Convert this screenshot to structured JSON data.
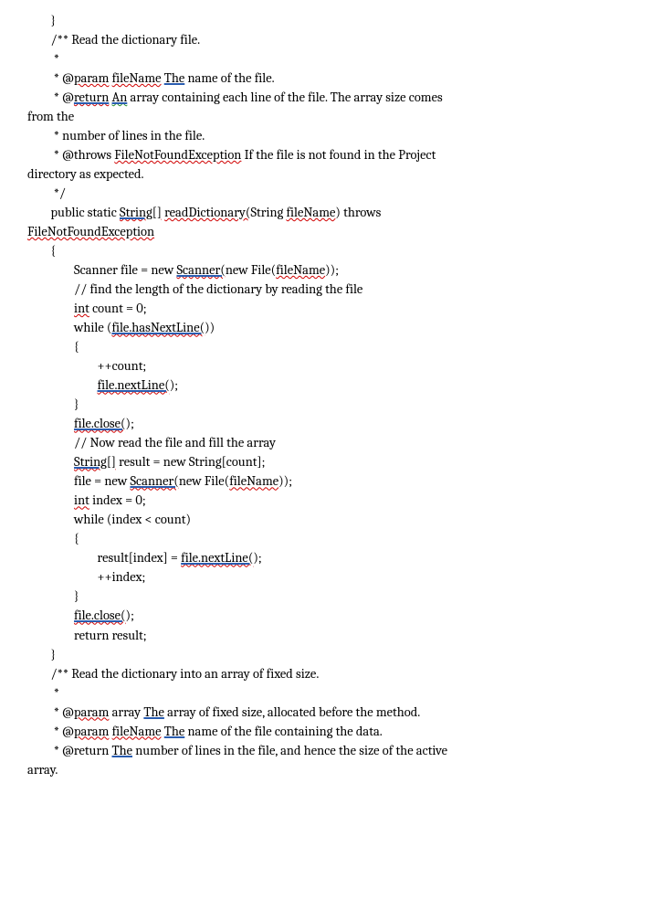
{
  "l1": "        }",
  "l2": "",
  "l3a": "        /** Read the dictionary file.",
  "l4": "         *",
  "l5_pre": "         * @",
  "l5_param": "param",
  "l5_sp": " ",
  "l5_fn": "fileName",
  "l5_sp2": " ",
  "l5_the": "The",
  "l5_rest": " name of the file.",
  "l6_pre": "         * @",
  "l6_ret": "return",
  "l6_sp": " ",
  "l6_an": "An",
  "l6_rest": " array containing each line of the file. The array size comes",
  "l7": "from the",
  "l8": "         * number of lines in the file.",
  "l9_pre": "         * @throws ",
  "l9_ex": "FileNotFoundException",
  "l9_rest": " If the file is not found in the Project",
  "l10": "directory as expected.",
  "l11": "         */",
  "l12_pre": "        public static ",
  "l12_str": "String[]",
  "l12_sp": " ",
  "l12_rd": "readDictionary(",
  "l12_mid": "String ",
  "l12_fn": "fileName",
  "l12_end": ") throws",
  "l13": "FileNotFoundException",
  "l14": "        {",
  "l15_pre": "                Scanner file = new ",
  "l15_scan": "Scanner(",
  "l15_mid": "new File(",
  "l15_fn": "fileName",
  "l15_end": "));",
  "l16": "",
  "l17": "                // find the length of the dictionary by reading the file",
  "l18_pre": "                ",
  "l18_int": "int",
  "l18_rest": " count = 0;",
  "l19_pre": "                while (",
  "l19_call": "file.hasNextLine(",
  "l19_end": "))",
  "l20": "                {",
  "l21": "                        ++count;",
  "l22_pre": "                        ",
  "l22_call": "file.nextLine(",
  "l22_end": ");",
  "l23": "                }",
  "l24_pre": "                ",
  "l24_call": "file.close(",
  "l24_end": ");",
  "l25": "",
  "l26": "                // Now read the file and fill the array",
  "l27_pre": "                ",
  "l27_str": "String[]",
  "l27_rest": " result = new String[count];",
  "l28_pre": "                file = new ",
  "l28_scan": "Scanner(",
  "l28_mid": "new File(",
  "l28_fn": "fileName",
  "l28_end": "));",
  "l29_pre": "                ",
  "l29_int": "int",
  "l29_rest": " index = 0;",
  "l30": "                while (index < count)",
  "l31": "                {",
  "l32_pre": "                        result[index] = ",
  "l32_call": "file.nextLine(",
  "l32_end": ");",
  "l33": "                        ++index;",
  "l34": "                }",
  "l35_pre": "                ",
  "l35_call": "file.close(",
  "l35_end": ");",
  "l36": "                return result;",
  "l37": "",
  "l38": "        }",
  "l39": "",
  "l40": "        /** Read the dictionary into an array of fixed size.",
  "l41": "         *",
  "l42_pre": "         * @",
  "l42_param": "param",
  "l42_sp": " ",
  "l42_arr": "array ",
  "l42_the": "The",
  "l42_rest": " array of fixed size, allocated before the method.",
  "l43_pre": "         * @",
  "l43_param": "param",
  "l43_sp": " ",
  "l43_fn": "fileName",
  "l43_sp2": " ",
  "l43_the": "The",
  "l43_rest": " name of the file containing the data.",
  "l44_pre": "         * @return ",
  "l44_the": "The",
  "l44_rest": " number of lines in the file, and hence the size of the active",
  "l45": "array."
}
